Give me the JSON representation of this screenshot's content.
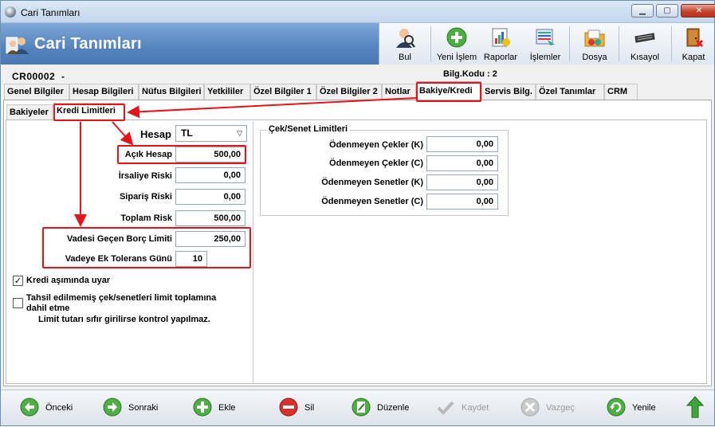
{
  "window": {
    "title": "Cari Tanımları",
    "minimize": "▁",
    "maximize": "▢",
    "close": "✕"
  },
  "header": {
    "title": "Cari Tanımları"
  },
  "toolbar": [
    {
      "label": "Bul",
      "icon": "search-person-icon"
    },
    {
      "label": "Yeni İşlem",
      "icon": "add-icon"
    },
    {
      "label": "Raporlar",
      "icon": "report-icon"
    },
    {
      "label": "İşlemler",
      "icon": "operations-icon"
    },
    {
      "label": "Dosya",
      "icon": "folder-icon"
    },
    {
      "label": "Kısayol",
      "icon": "keyboard-icon"
    },
    {
      "label": "Kapat",
      "icon": "exit-door-icon"
    }
  ],
  "record": {
    "code": "CR00002",
    "dash": "-",
    "bilg_kodu": "Bilg.Kodu : 2"
  },
  "tabs": [
    "Genel Bilgiler",
    "Hesap Bilgileri",
    "Nüfus Bilgileri",
    "Yetkililer",
    "Özel Bilgiler 1",
    "Özel Bilgiler 2",
    "Notlar",
    "Bakiye/Kredi",
    "Servis Bilg.",
    "Özel Tanımlar",
    "CRM"
  ],
  "subtabs": [
    "Bakiyeler",
    "Kredi Limitleri"
  ],
  "credit": {
    "hesap_label": "Hesap",
    "hesap_value": "TL",
    "rows": [
      {
        "label": "Açık Hesap",
        "value": "500,00"
      },
      {
        "label": "İrsaliye Riski",
        "value": "0,00"
      },
      {
        "label": "Sipariş Riski",
        "value": "0,00"
      },
      {
        "label": "Toplam Risk",
        "value": "500,00"
      },
      {
        "label": "Vadesi Geçen Borç Limiti",
        "value": "250,00"
      },
      {
        "label": "Vadeye Ek Tolerans Günü",
        "value": "10"
      }
    ],
    "check1": {
      "label": "Kredi aşımında uyar",
      "checked": true,
      "mark": "✓"
    },
    "check2": {
      "label_line1": "Tahsil edilmemiş çek/senetleri limit toplamına",
      "label_line2": "dahil etme",
      "checked": false,
      "mark": ""
    },
    "note": "Limit tutarı sıfır girilirse kontrol yapılmaz."
  },
  "cek_senet": {
    "title": "Çek/Senet Limitleri",
    "rows": [
      {
        "label": "Ödenmeyen Çekler (K)",
        "value": "0,00"
      },
      {
        "label": "Ödenmeyen Çekler (C)",
        "value": "0,00"
      },
      {
        "label": "Ödenmeyen Senetler (K)",
        "value": "0,00"
      },
      {
        "label": "Ödenmeyen Senetler (C)",
        "value": "0,00"
      }
    ]
  },
  "bottom": [
    {
      "label": "Önceki",
      "enabled": true
    },
    {
      "label": "Sonraki",
      "enabled": true
    },
    {
      "label": "Ekle",
      "enabled": true
    },
    {
      "label": "Sil",
      "enabled": true
    },
    {
      "label": "Düzenle",
      "enabled": true
    },
    {
      "label": "Kaydet",
      "enabled": false
    },
    {
      "label": "Vazgeç",
      "enabled": false
    },
    {
      "label": "Yenile",
      "enabled": true
    },
    {
      "label": "",
      "enabled": true
    }
  ],
  "colors": {
    "header_blue": "#5483bd",
    "highlight_red": "#e3141a",
    "active_green": "#3fa53a"
  }
}
